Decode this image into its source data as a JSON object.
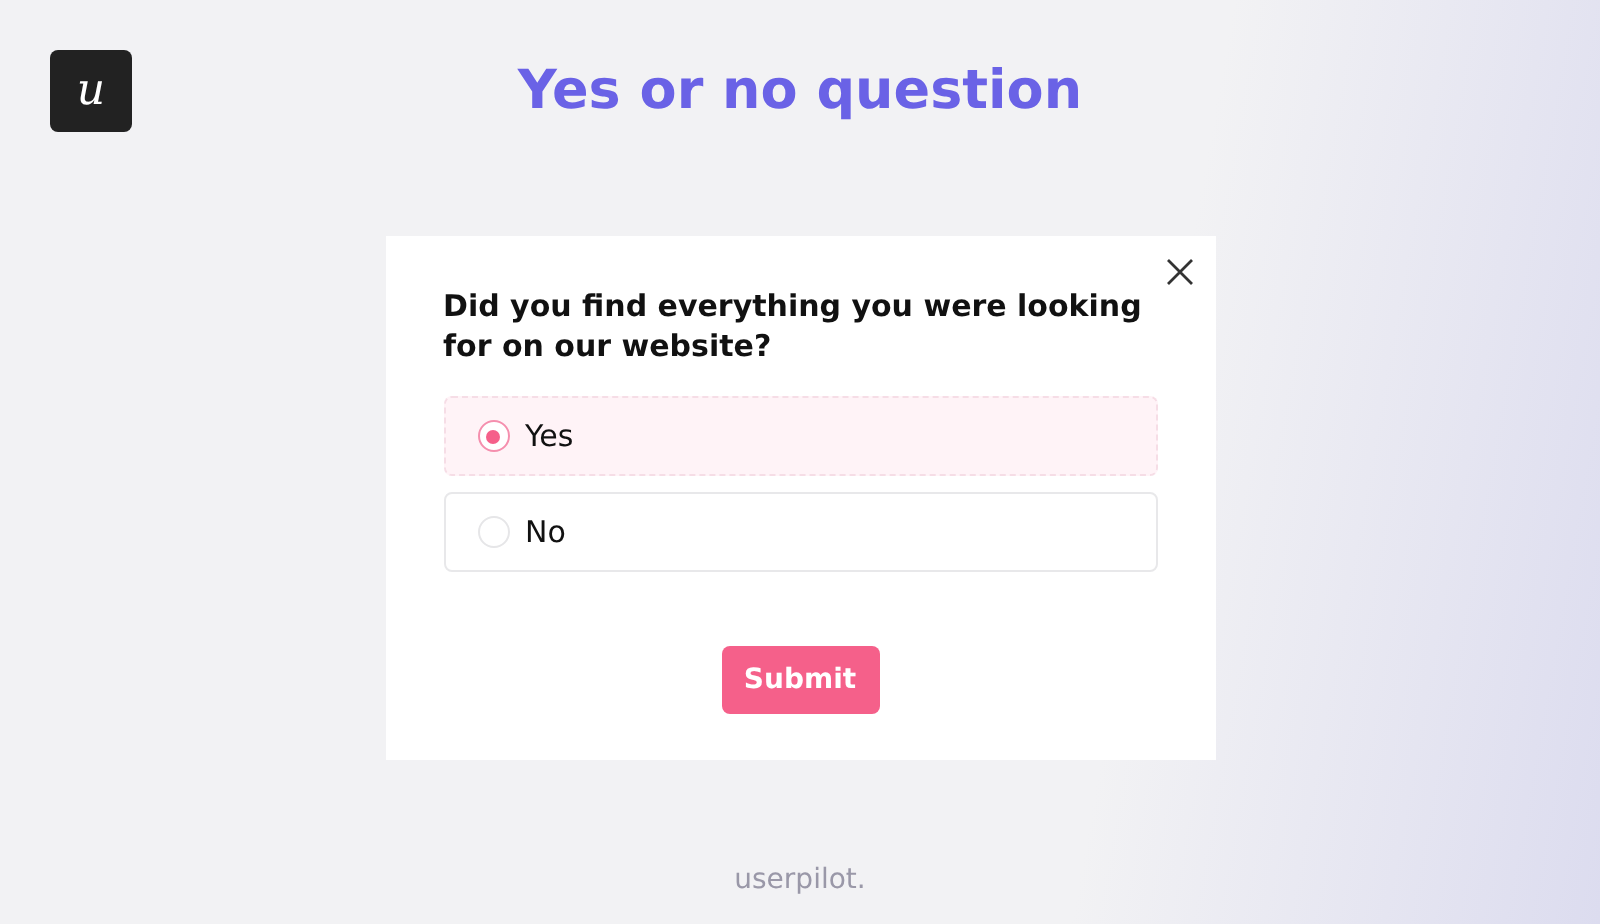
{
  "logo": {
    "letter": "u"
  },
  "title": "Yes or no question",
  "survey": {
    "question": "Did you find everything you were looking for on our website?",
    "options": [
      {
        "label": "Yes",
        "selected": true
      },
      {
        "label": "No",
        "selected": false
      }
    ],
    "submit": "Submit"
  },
  "footer": "userpilot."
}
